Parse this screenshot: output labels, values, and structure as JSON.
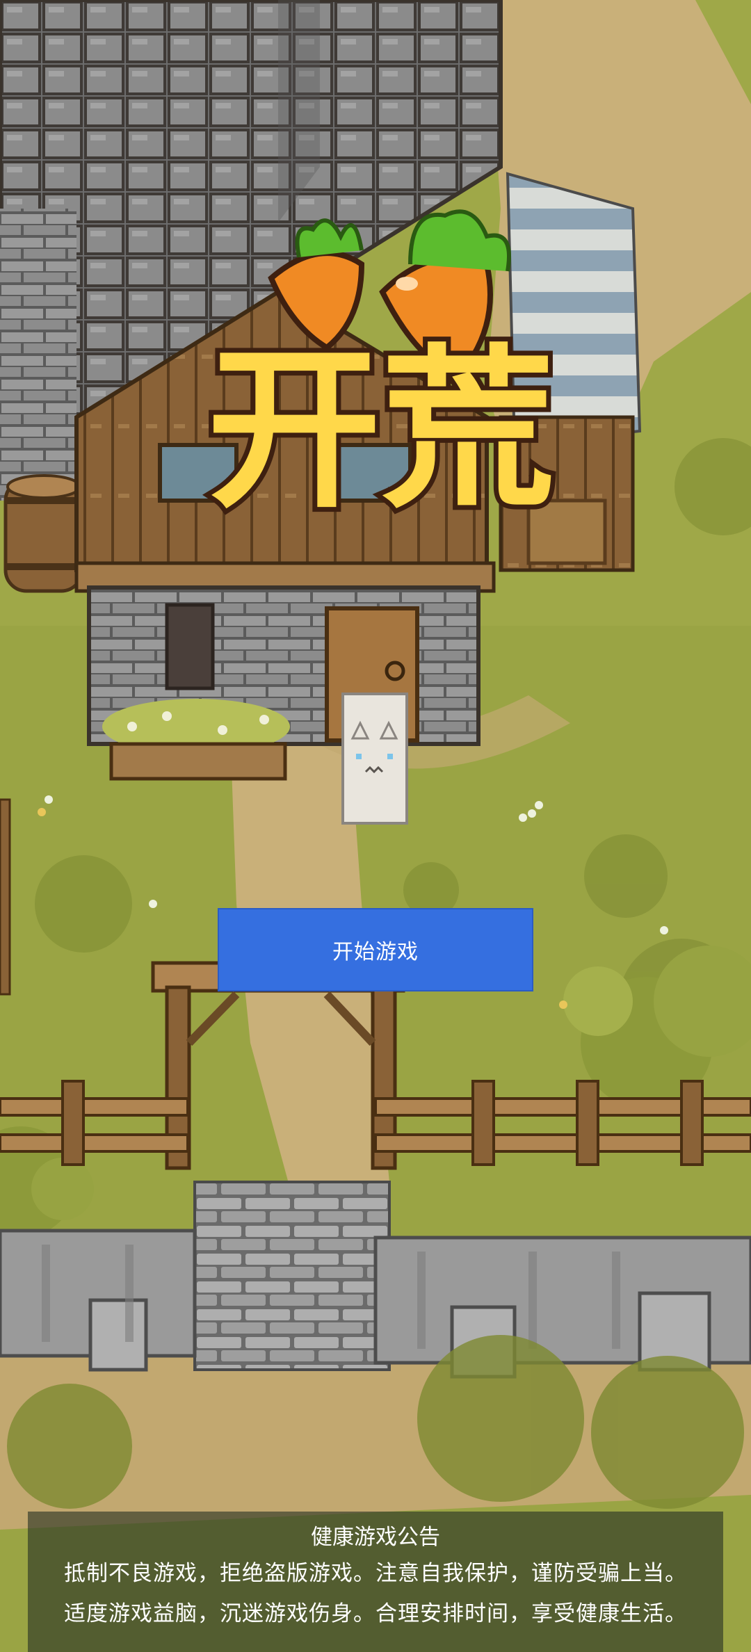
{
  "logo": {
    "text": "开荒"
  },
  "start_button": {
    "label": "开始游戏"
  },
  "health_notice": {
    "title": "健康游戏公告",
    "line1": "抵制不良游戏，拒绝盗版游戏。注意自我保护，谨防受骗上当。",
    "line2": "适度游戏益脑，沉迷游戏伤身。合理安排时间，享受健康生活。"
  },
  "colors": {
    "grass": "#9aa444",
    "path": "#c9b079",
    "roof": "#6f6f6f",
    "button": "#356fe0",
    "logo_fill": "#ffd84a",
    "carrot": "#f08a24"
  }
}
